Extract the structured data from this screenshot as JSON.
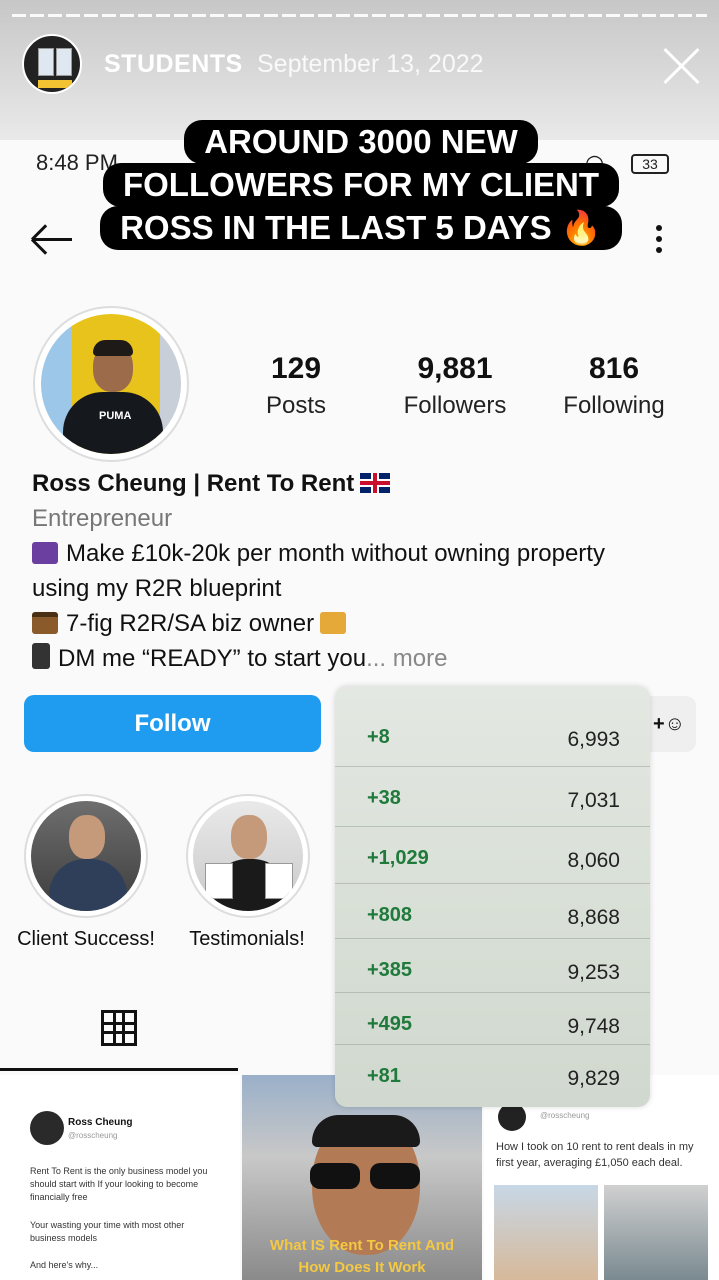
{
  "story": {
    "username": "STUDENTS",
    "date": "September 13, 2022",
    "caption_lines": [
      "AROUND 3000 NEW",
      "FOLLOWERS FOR MY CLIENT",
      "ROSS IN THE LAST 5 DAYS 🔥"
    ]
  },
  "status_bar": {
    "time": "8:48 PM",
    "battery": "33"
  },
  "profile": {
    "stats": [
      {
        "value": "129",
        "label": "Posts"
      },
      {
        "value": "9,881",
        "label": "Followers"
      },
      {
        "value": "816",
        "label": "Following"
      }
    ],
    "name": "Ross Cheung | Rent To Rent",
    "category": "Entrepreneur",
    "bio_line1": "Make £10k-20k per month without owning property",
    "bio_line2": "using my R2R blueprint",
    "bio_line3": "7-fig R2R/SA biz owner",
    "bio_line4": "DM me “READY” to start you",
    "bio_more": "... more",
    "avatar_shirt_text": "PUMA"
  },
  "actions": {
    "follow_label": "Follow",
    "add_person_label": "+&#x1F464;"
  },
  "highlights": [
    {
      "label": "Client Success!"
    },
    {
      "label": "Testimonials!"
    }
  ],
  "growth_table": [
    {
      "delta": "+8",
      "total": "6,993"
    },
    {
      "delta": "+38",
      "total": "7,031"
    },
    {
      "delta": "+1,029",
      "total": "8,060"
    },
    {
      "delta": "+808",
      "total": "8,868"
    },
    {
      "delta": "+385",
      "total": "9,253"
    },
    {
      "delta": "+495",
      "total": "9,748"
    },
    {
      "delta": "+81",
      "total": "9,829"
    }
  ],
  "posts": {
    "post1": {
      "name": "Ross Cheung",
      "handle": "@rosscheung",
      "p1": "Rent To Rent is the only business model you should start with If your looking to become financially free",
      "p2": "Your wasting your time with most other business models",
      "p3": "And here's why..."
    },
    "post2": {
      "caption": "What IS Rent To Rent And How Does It Work"
    },
    "post3": {
      "handle": "@rosscheung",
      "text": "How I took on 10 rent to rent deals in my first year, averaging £1,050 each deal."
    }
  }
}
